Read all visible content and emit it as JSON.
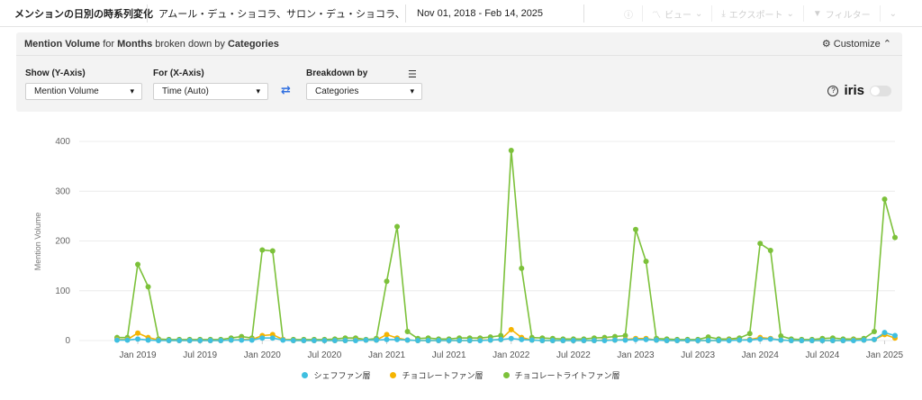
{
  "topbar": {
    "title": "メンションの日別の時系列変化",
    "brands": "アムール・デュ・ショコラ、サロン・デュ・ショコラ、...",
    "dates": "Nov 01, 2018 - Feb 14, 2025",
    "tools": [
      {
        "icon": "info-icon",
        "label": ""
      },
      {
        "icon": "chart-line-icon",
        "label": "ビュー"
      },
      {
        "icon": "download-icon",
        "label": "エクスポート"
      },
      {
        "icon": "filter-icon",
        "label": "フィルター"
      },
      {
        "icon": "chevron-down-icon",
        "label": ""
      }
    ]
  },
  "panel": {
    "title_parts": [
      "Mention Volume",
      " for ",
      "Months",
      " broken down by ",
      "Categories"
    ],
    "customize": "Customize",
    "show_label": "Show (Y-Axis)",
    "show_value": "Mention Volume",
    "for_label": "For (X-Axis)",
    "for_value": "Time (Auto)",
    "breakdown_label": "Breakdown by",
    "breakdown_value": "Categories",
    "iris": "iris"
  },
  "chart_data": {
    "type": "line",
    "ylabel": "Mention Volume",
    "xlabel": "",
    "ylim": [
      0,
      400
    ],
    "yticks": [
      0,
      100,
      200,
      300,
      400
    ],
    "xtick_labels": [
      "Jan 2019",
      "Jul 2019",
      "Jan 2020",
      "Jul 2020",
      "Jan 2021",
      "Jul 2021",
      "Jan 2022",
      "Jul 2022",
      "Jan 2023",
      "Jul 2023",
      "Jan 2024",
      "Jul 2024",
      "Jan 2025"
    ],
    "x": [
      "2018-11",
      "2018-12",
      "2019-01",
      "2019-02",
      "2019-03",
      "2019-04",
      "2019-05",
      "2019-06",
      "2019-07",
      "2019-08",
      "2019-09",
      "2019-10",
      "2019-11",
      "2019-12",
      "2020-01",
      "2020-02",
      "2020-03",
      "2020-04",
      "2020-05",
      "2020-06",
      "2020-07",
      "2020-08",
      "2020-09",
      "2020-10",
      "2020-11",
      "2020-12",
      "2021-01",
      "2021-02",
      "2021-03",
      "2021-04",
      "2021-05",
      "2021-06",
      "2021-07",
      "2021-08",
      "2021-09",
      "2021-10",
      "2021-11",
      "2021-12",
      "2022-01",
      "2022-02",
      "2022-03",
      "2022-04",
      "2022-05",
      "2022-06",
      "2022-07",
      "2022-08",
      "2022-09",
      "2022-10",
      "2022-11",
      "2022-12",
      "2023-01",
      "2023-02",
      "2023-03",
      "2023-04",
      "2023-05",
      "2023-06",
      "2023-07",
      "2023-08",
      "2023-09",
      "2023-10",
      "2023-11",
      "2023-12",
      "2024-01",
      "2024-02",
      "2024-03",
      "2024-04",
      "2024-05",
      "2024-06",
      "2024-07",
      "2024-08",
      "2024-09",
      "2024-10",
      "2024-11",
      "2024-12",
      "2025-01",
      "2025-02"
    ],
    "series": [
      {
        "name": "シェフファン層",
        "color": "#3fbfe0",
        "values": [
          1,
          1,
          3,
          1,
          0,
          0,
          0,
          0,
          0,
          0,
          0,
          1,
          1,
          1,
          5,
          5,
          1,
          0,
          0,
          0,
          0,
          0,
          0,
          0,
          1,
          1,
          2,
          2,
          1,
          0,
          0,
          0,
          0,
          0,
          0,
          0,
          1,
          2,
          4,
          2,
          1,
          0,
          0,
          0,
          0,
          0,
          0,
          0,
          1,
          1,
          2,
          2,
          1,
          0,
          0,
          0,
          0,
          0,
          0,
          0,
          1,
          1,
          3,
          3,
          1,
          0,
          0,
          0,
          0,
          0,
          0,
          0,
          1,
          2,
          16,
          10
        ]
      },
      {
        "name": "チョコレートファン層",
        "color": "#f5b400",
        "values": [
          2,
          2,
          15,
          6,
          1,
          0,
          0,
          0,
          0,
          0,
          0,
          1,
          2,
          2,
          10,
          12,
          2,
          0,
          0,
          0,
          0,
          0,
          0,
          1,
          1,
          1,
          12,
          5,
          1,
          0,
          0,
          0,
          0,
          0,
          0,
          1,
          1,
          2,
          22,
          6,
          1,
          0,
          0,
          0,
          0,
          0,
          0,
          1,
          1,
          2,
          4,
          4,
          1,
          0,
          0,
          0,
          0,
          0,
          0,
          1,
          1,
          2,
          6,
          4,
          1,
          0,
          0,
          0,
          0,
          0,
          0,
          1,
          1,
          2,
          12,
          5
        ]
      },
      {
        "name": "チョコレートライトファン層",
        "color": "#7cc13a",
        "values": [
          6,
          6,
          153,
          108,
          3,
          2,
          2,
          2,
          2,
          2,
          2,
          5,
          8,
          5,
          182,
          180,
          2,
          2,
          2,
          2,
          2,
          3,
          5,
          5,
          2,
          4,
          119,
          229,
          18,
          4,
          5,
          3,
          3,
          5,
          5,
          5,
          7,
          10,
          382,
          145,
          6,
          5,
          4,
          3,
          3,
          3,
          5,
          6,
          8,
          10,
          223,
          159,
          4,
          3,
          2,
          2,
          2,
          7,
          3,
          3,
          5,
          14,
          195,
          181,
          9,
          3,
          2,
          2,
          4,
          5,
          3,
          3,
          4,
          18,
          284,
          207
        ]
      }
    ]
  }
}
